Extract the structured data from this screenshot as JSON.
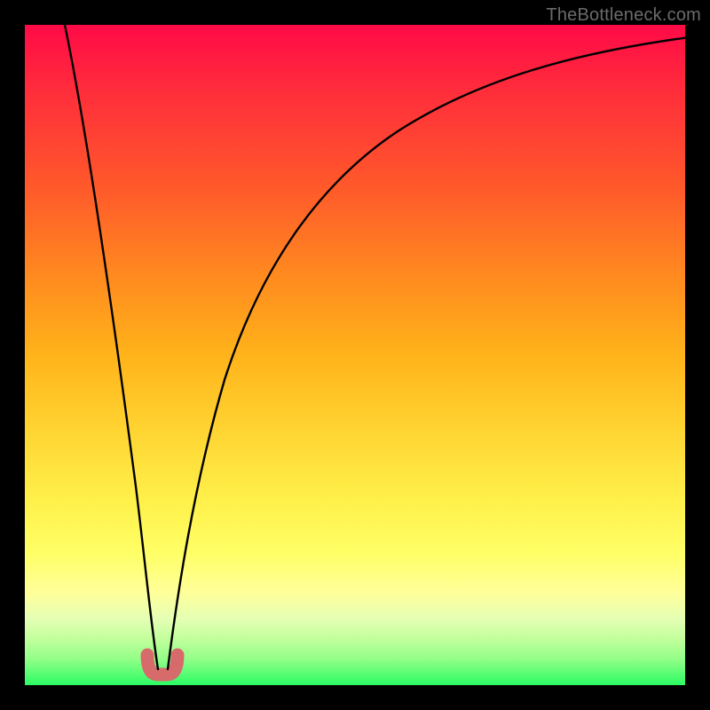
{
  "watermark": "TheBottleneck.com",
  "chart_data": {
    "type": "line",
    "title": "",
    "xlabel": "",
    "ylabel": "",
    "xlim": [
      0,
      100
    ],
    "ylim": [
      0,
      100
    ],
    "series": [
      {
        "name": "bottleneck-curve",
        "x": [
          0,
          2,
          5,
          8,
          10,
          12,
          14,
          16,
          17,
          18,
          19,
          20,
          21,
          22,
          23,
          24,
          26,
          28,
          30,
          33,
          36,
          40,
          45,
          50,
          55,
          60,
          65,
          70,
          75,
          80,
          85,
          90,
          95,
          100
        ],
        "y": [
          100,
          92,
          82,
          71,
          63,
          55,
          46,
          35,
          27,
          18,
          6,
          2,
          2,
          6,
          15,
          25,
          38,
          47,
          54,
          61,
          66,
          72,
          77,
          81,
          84,
          86,
          88,
          89.5,
          90.7,
          91.7,
          92.5,
          93.2,
          93.8,
          94.3
        ]
      }
    ],
    "markers": [
      {
        "name": "highlight-region",
        "x_start": 18.6,
        "x_end": 22.2,
        "y_level": 2.5
      }
    ],
    "colors": {
      "curve": "#000000",
      "marker": "#d76b6b",
      "gradient_top": "#ff0a47",
      "gradient_bottom": "#2bfb64",
      "background": "#000000"
    }
  }
}
